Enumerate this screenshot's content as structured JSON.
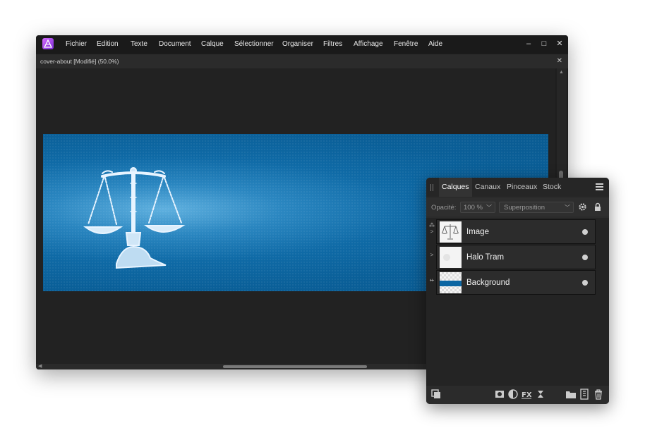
{
  "menu": {
    "items": [
      "Fichier",
      "Edition",
      "Texte",
      "Document",
      "Calque",
      "Sélectionner",
      "Organiser",
      "Filtres",
      "Affichage",
      "Fenêtre",
      "Aide"
    ]
  },
  "window_controls": {
    "minimize": "–",
    "maximize": "□",
    "close": "✕"
  },
  "document": {
    "title": "cover-about [Modifié] (50.0%)",
    "close": "✕"
  },
  "layers_panel": {
    "tabs": [
      "Calques",
      "Canaux",
      "Pinceaux",
      "Stock"
    ],
    "opacity_label": "Opacité:",
    "opacity_value": "100 %",
    "blend_mode": "Superposition",
    "layers": [
      {
        "name": "Image"
      },
      {
        "name": "Halo Tram"
      },
      {
        "name": "Background"
      }
    ]
  },
  "colors": {
    "accent": "#0b66a3",
    "app_bg": "#1e1e1e",
    "panel_bg": "#2b2b2b"
  }
}
